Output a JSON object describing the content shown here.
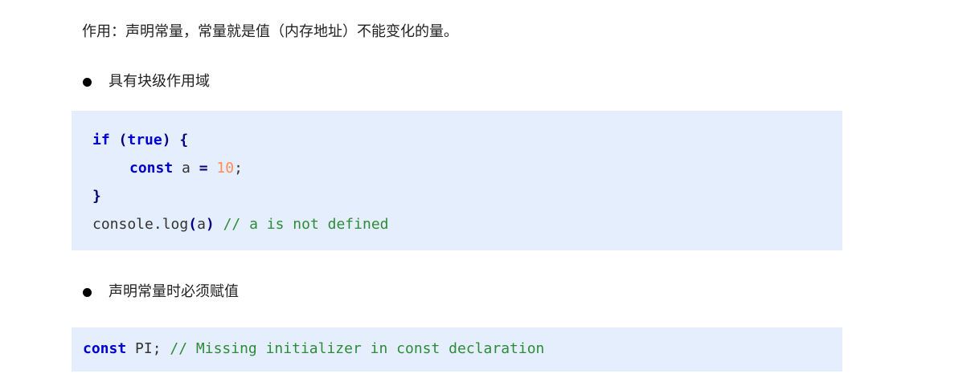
{
  "intro": "作用：声明常量，常量就是值（内存地址）不能变化的量。",
  "bullets": [
    {
      "label": "具有块级作用域"
    },
    {
      "label": "声明常量时必须赋值"
    }
  ],
  "code_block_1": {
    "line1": {
      "kw": "if",
      "open": "(",
      "value": "true",
      "close": ")",
      "brace": "{"
    },
    "line2": {
      "kw": "const",
      "var": "a",
      "op": "=",
      "num": "10",
      "semi": ";"
    },
    "line3": {
      "brace": "}"
    },
    "line4": {
      "obj": "console.log",
      "open": "(",
      "arg": "a",
      "close": ")",
      "comment": "// a is not defined"
    }
  },
  "code_block_2": {
    "line1": {
      "kw": "const",
      "rest": "PI;",
      "comment": "// Missing initializer in const declaration"
    }
  },
  "colors": {
    "code_background": "#e4eefc",
    "keyword": "#0000cc",
    "number": "#ff8c5a",
    "comment": "#2e8b3a"
  }
}
